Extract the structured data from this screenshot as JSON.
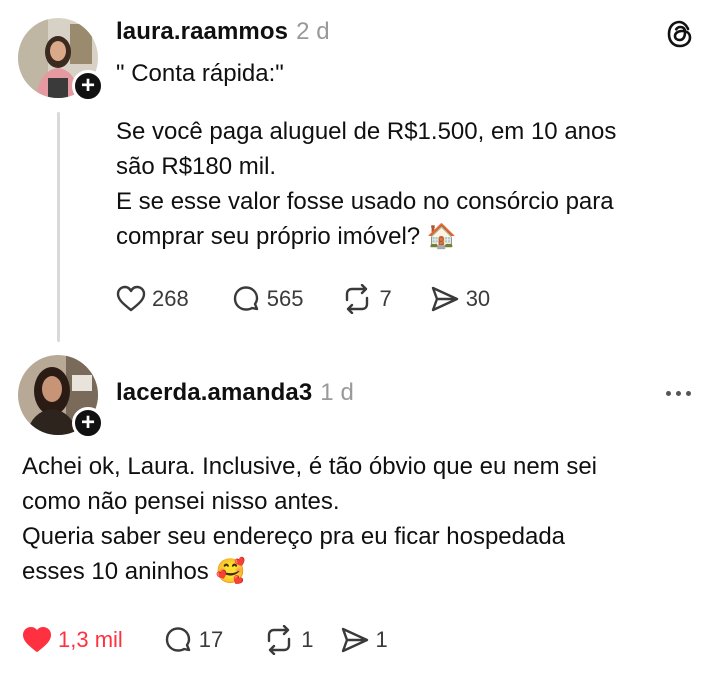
{
  "post": {
    "username": "laura.raammos",
    "time": "2 d",
    "lines": [
      "\" Conta rápida:\"",
      "",
      "Se você paga aluguel de R$1.500, em 10 anos",
      "são R$180 mil.",
      "E se esse valor fosse usado no consórcio para",
      "comprar seu próprio imóvel? 🏠"
    ],
    "stats": {
      "likes": "268",
      "replies": "565",
      "reposts": "7",
      "shares": "30"
    }
  },
  "reply": {
    "username": "lacerda.amanda3",
    "time": "1 d",
    "lines": [
      "Achei ok, Laura. Inclusive, é tão óbvio que eu nem sei",
      "como não pensei nisso antes.",
      "Queria saber seu endereço pra eu ficar hospedada",
      "esses 10 aninhos 🥰"
    ],
    "stats": {
      "likes": "1,3 mil",
      "replies": "17",
      "reposts": "1",
      "shares": "1"
    }
  },
  "colors": {
    "liked": "#ff3040",
    "muted": "#999999",
    "text": "#101010"
  }
}
